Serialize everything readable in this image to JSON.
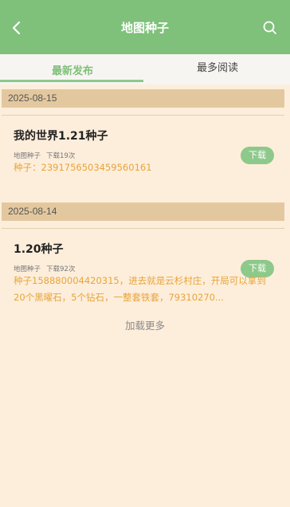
{
  "header": {
    "title": "地图种子"
  },
  "tabs": [
    {
      "label": "最新发布"
    },
    {
      "label": "最多阅读"
    }
  ],
  "sections": [
    {
      "date": "2025-08-15",
      "item": {
        "title": "我的世界1.21种子",
        "category": "地图种子",
        "downloads": "下载19次",
        "seed_text": "种子：2391756503459560161",
        "button": "下载"
      }
    },
    {
      "date": "2025-08-14",
      "item": {
        "title": "1.20种子",
        "category": "地图种子",
        "downloads": "下载92次",
        "seed_text": "种子158880004420315，进去就是云杉村庄，开局可以拿到20个黑曜石，5个钻石，一整套铁套，79310270...",
        "button": "下载"
      }
    }
  ],
  "footer": {
    "load_more": "加载更多"
  },
  "colors": {
    "accent": "#7fc07a",
    "date_bar": "#e3c89f",
    "seed_text": "#e8a43a",
    "background": "#fdeedb"
  }
}
